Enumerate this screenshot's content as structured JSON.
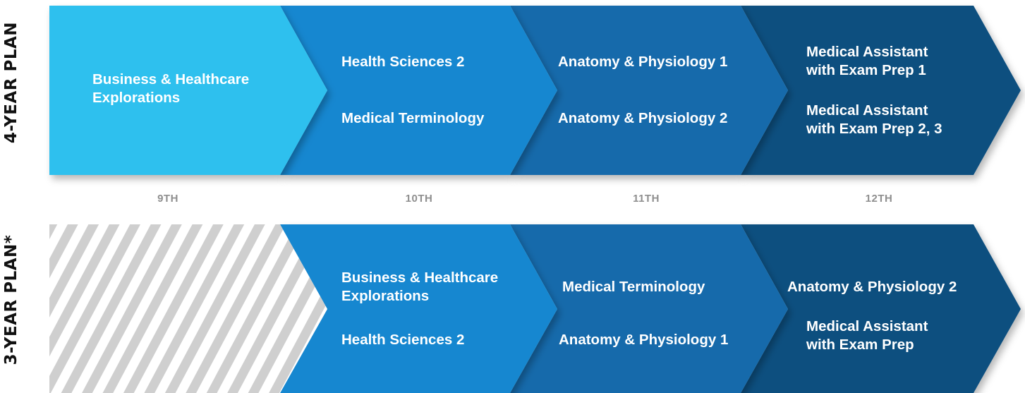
{
  "plans": [
    {
      "label": "4-YEAR PLAN",
      "segments": [
        {
          "color": "#2ec0ee",
          "courses": [
            "Business & Healthcare Explorations"
          ]
        },
        {
          "color": "#1587d0",
          "courses": [
            "Health Sciences 2",
            "Medical Terminology"
          ]
        },
        {
          "color": "#136bab",
          "courses": [
            "Anatomy & Physiology 1",
            "Anatomy & Physiology 2"
          ]
        },
        {
          "color": "#0d4f7f",
          "courses": [
            "Medical Assistant with Exam Prep 1",
            "Medical Assistant with Exam Prep 2, 3"
          ]
        }
      ]
    },
    {
      "label": "3-YEAR PLAN*",
      "segments": [
        {
          "color": "hatched",
          "courses": []
        },
        {
          "color": "#1587d0",
          "courses": [
            "Business & Healthcare Explorations",
            "Health Sciences 2"
          ]
        },
        {
          "color": "#136bab",
          "courses": [
            "Medical Terminology",
            "Anatomy & Physiology 1"
          ]
        },
        {
          "color": "#0d4f7f",
          "courses": [
            "Anatomy & Physiology 2",
            "Medical Assistant with Exam Prep"
          ]
        }
      ]
    }
  ],
  "grades": [
    "9TH",
    "10TH",
    "11TH",
    "12TH"
  ]
}
